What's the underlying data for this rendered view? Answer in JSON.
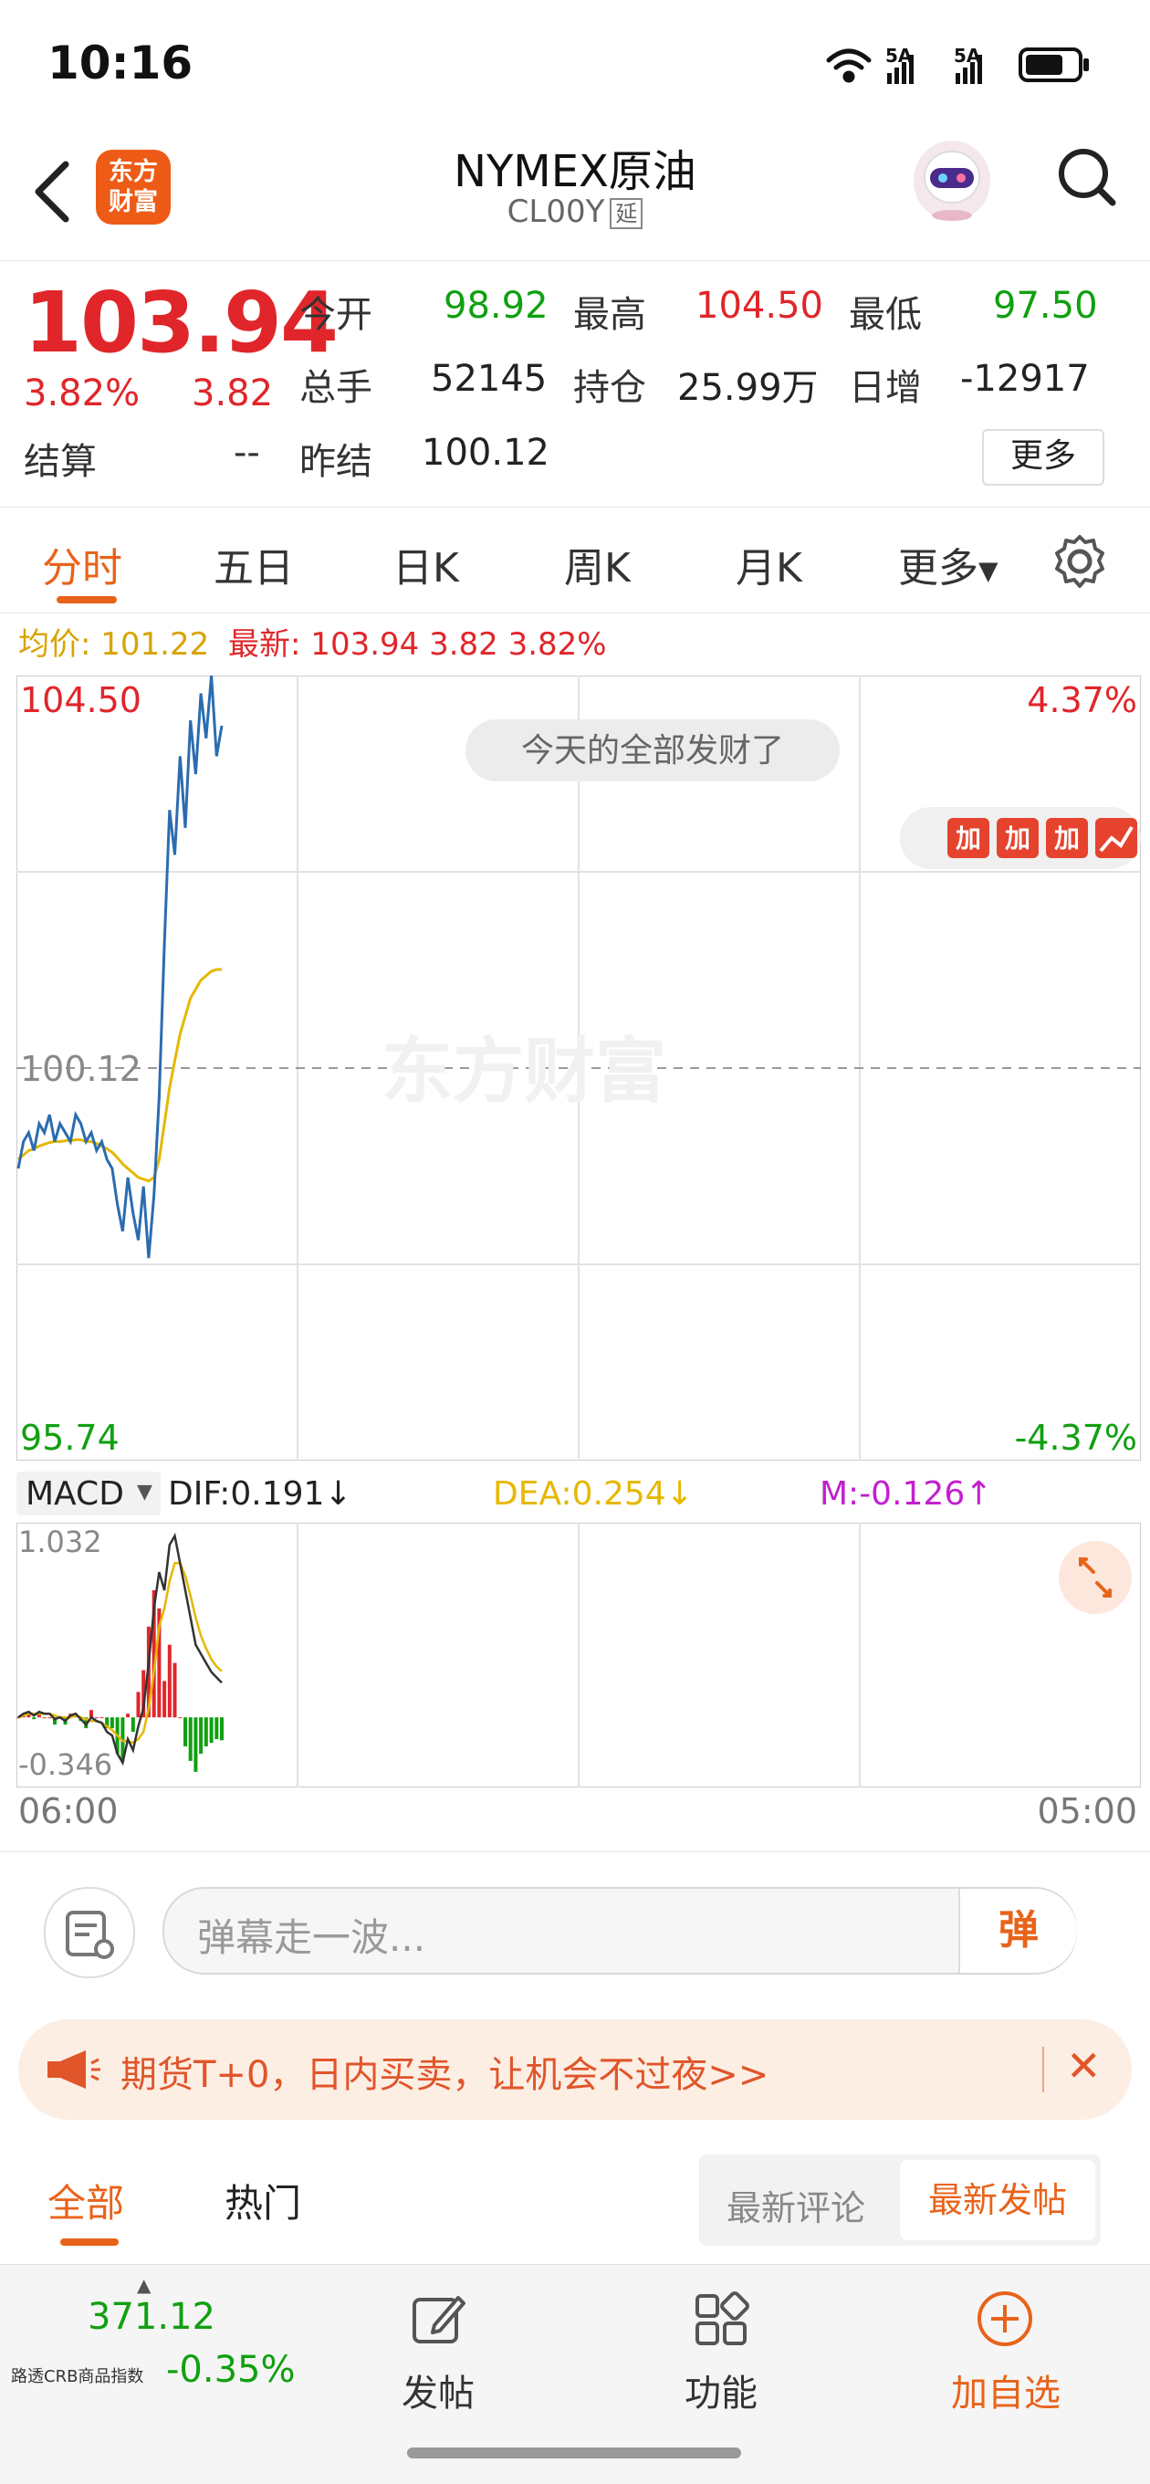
{
  "status_bar": {
    "time": "10:16",
    "signal1": "5A",
    "signal2": "5A"
  },
  "header": {
    "title": "NYMEX原油",
    "code": "CL00Y",
    "delay_tag": "延",
    "logo_line1": "东方",
    "logo_line2": "财富"
  },
  "quote": {
    "price": "103.94",
    "change_pct": "3.82%",
    "change": "3.82",
    "open_label": "今开",
    "open": "98.92",
    "high_label": "最高",
    "high": "104.50",
    "low_label": "最低",
    "low": "97.50",
    "volume_label": "总手",
    "volume": "52145",
    "position_label": "持仓",
    "position": "25.99万",
    "daily_inc_label": "日增",
    "daily_inc": "-12917",
    "settle_label": "结算",
    "settle": "--",
    "prev_settle_label": "昨结",
    "prev_settle": "100.12",
    "more_button": "更多"
  },
  "tabs": [
    "分时",
    "五日",
    "日K",
    "周K",
    "月K",
    "更多"
  ],
  "info_row": {
    "avg_label": "均价: 101.22",
    "latest_label": "最新: 103.94 3.82 3.82%"
  },
  "chart_data": {
    "type": "line",
    "y_top_label": "104.50",
    "y_mid_label": "100.12",
    "y_bottom_label": "95.74",
    "pct_top_label": "4.37%",
    "pct_bottom_label": "-4.37%",
    "ylim": [
      95.74,
      104.5
    ],
    "x_start_label": "06:00",
    "x_end_label": "05:00",
    "watermark": "东方财富",
    "bubble_text": "今天的全部发财了",
    "series": [
      {
        "name": "最新",
        "color": "#2b6cb0",
        "values": [
          99.0,
          99.3,
          99.4,
          99.2,
          99.5,
          99.4,
          99.6,
          99.3,
          99.5,
          99.4,
          99.3,
          99.6,
          99.5,
          99.3,
          99.4,
          99.2,
          99.3,
          99.1,
          99.0,
          98.6,
          98.3,
          98.9,
          98.5,
          98.2,
          98.8,
          98.0,
          98.7,
          99.8,
          101.5,
          103.0,
          102.5,
          103.6,
          102.8,
          104.0,
          103.4,
          104.3,
          103.8,
          104.5,
          103.6,
          103.94
        ]
      },
      {
        "name": "均价",
        "color": "#e6b800",
        "values": [
          99.1,
          99.15,
          99.2,
          99.22,
          99.25,
          99.27,
          99.29,
          99.3,
          99.3,
          99.31,
          99.31,
          99.32,
          99.32,
          99.3,
          99.3,
          99.28,
          99.25,
          99.22,
          99.18,
          99.12,
          99.05,
          99.0,
          98.95,
          98.9,
          98.88,
          98.86,
          98.9,
          99.1,
          99.5,
          99.9,
          100.2,
          100.5,
          100.7,
          100.9,
          101.0,
          101.1,
          101.15,
          101.2,
          101.22,
          101.22
        ]
      }
    ],
    "session_fraction": 0.181
  },
  "macd": {
    "label": "MACD",
    "dif": "DIF:0.191↓",
    "dea": "DEA:0.254↓",
    "m": "M:-0.126↑",
    "top_label": "1.032",
    "bottom_label": "-0.346",
    "ylim": [
      -0.346,
      1.032
    ],
    "dif_values": [
      0.0,
      0.02,
      0.03,
      0.01,
      0.03,
      0.02,
      0.02,
      -0.01,
      0.0,
      -0.02,
      0.01,
      0.02,
      -0.01,
      -0.04,
      0.0,
      -0.02,
      -0.03,
      -0.08,
      -0.1,
      -0.2,
      -0.25,
      -0.12,
      -0.18,
      -0.05,
      0.05,
      0.3,
      0.6,
      0.8,
      0.7,
      0.95,
      1.0,
      0.85,
      0.7,
      0.55,
      0.4,
      0.35,
      0.3,
      0.25,
      0.22,
      0.191
    ],
    "dea_values": [
      0.0,
      0.01,
      0.02,
      0.02,
      0.02,
      0.02,
      0.02,
      0.01,
      0.0,
      0.0,
      0.0,
      0.01,
      0.0,
      -0.01,
      -0.02,
      -0.02,
      -0.03,
      -0.05,
      -0.07,
      -0.1,
      -0.13,
      -0.13,
      -0.14,
      -0.12,
      -0.08,
      0.05,
      0.25,
      0.5,
      0.6,
      0.75,
      0.85,
      0.85,
      0.78,
      0.67,
      0.55,
      0.45,
      0.38,
      0.32,
      0.28,
      0.254
    ],
    "hist_values": [
      0.0,
      0.02,
      0.02,
      -0.01,
      0.02,
      0.0,
      0.0,
      -0.04,
      0.0,
      -0.04,
      0.02,
      0.02,
      -0.02,
      -0.06,
      0.04,
      0.0,
      0.0,
      -0.06,
      -0.06,
      -0.2,
      -0.24,
      0.02,
      -0.08,
      0.14,
      0.26,
      0.5,
      0.7,
      0.6,
      0.2,
      0.4,
      0.3,
      0.0,
      -0.16,
      -0.24,
      -0.3,
      -0.2,
      -0.16,
      -0.14,
      -0.12,
      -0.126
    ]
  },
  "danmaku": {
    "placeholder": "弹幕走一波...",
    "send_label": "弹"
  },
  "banner": {
    "text": "期货T+0，日内买卖，让机会不过夜>>",
    "close": "✕"
  },
  "discussion": {
    "tab_all": "全部",
    "tab_hot": "热门",
    "seg_latest_comment": "最新评论",
    "seg_latest_post": "最新发帖"
  },
  "bottom_bar": {
    "index_value": "371.12",
    "index_name": "路透CRB商品指数",
    "index_change": "-0.35%",
    "post_label": "发帖",
    "func_label": "功能",
    "add_label": "加自选"
  },
  "colors": {
    "accent": "#e8631a",
    "up": "#e0262a",
    "down": "#10a010"
  }
}
